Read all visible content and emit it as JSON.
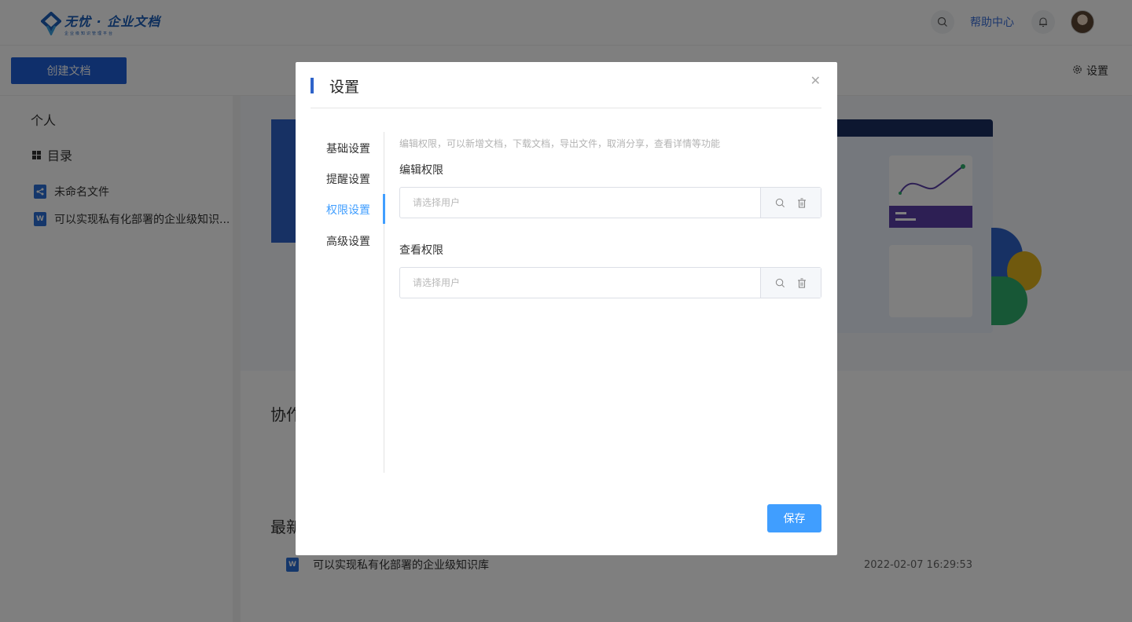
{
  "header": {
    "logo_title": "无忧 · 企业文档",
    "logo_subtitle": "企业级知识管理平台",
    "help_label": "帮助中心"
  },
  "toolbar": {
    "create_label": "创建文档",
    "settings_label": "设置"
  },
  "sidebar": {
    "section_personal": "个人",
    "catalog_label": "目录",
    "files": [
      {
        "name": "未命名文件",
        "icon": "share-file-icon"
      },
      {
        "name": "可以实现私有化部署的企业级知识...",
        "icon": "word-file-icon"
      }
    ]
  },
  "main": {
    "collab_title": "协作",
    "recent_title": "最新",
    "recent_files": [
      {
        "name": "可以实现私有化部署的企业级知识库",
        "time": "2022-02-07 16:29:53"
      }
    ]
  },
  "modal": {
    "title": "设置",
    "tabs": [
      {
        "label": "基础设置",
        "active": false
      },
      {
        "label": "提醒设置",
        "active": false
      },
      {
        "label": "权限设置",
        "active": true
      },
      {
        "label": "高级设置",
        "active": false
      }
    ],
    "hint": "编辑权限，可以新增文档，下载文档，导出文件，取消分享，查看详情等功能",
    "edit_label": "编辑权限",
    "edit_placeholder": "请选择用户",
    "view_label": "查看权限",
    "view_placeholder": "请选择用户",
    "save_label": "保存"
  },
  "colors": {
    "brand": "#1f5fd6",
    "accent": "#409eff",
    "overlay": "rgba(0,0,0,0.5)"
  }
}
